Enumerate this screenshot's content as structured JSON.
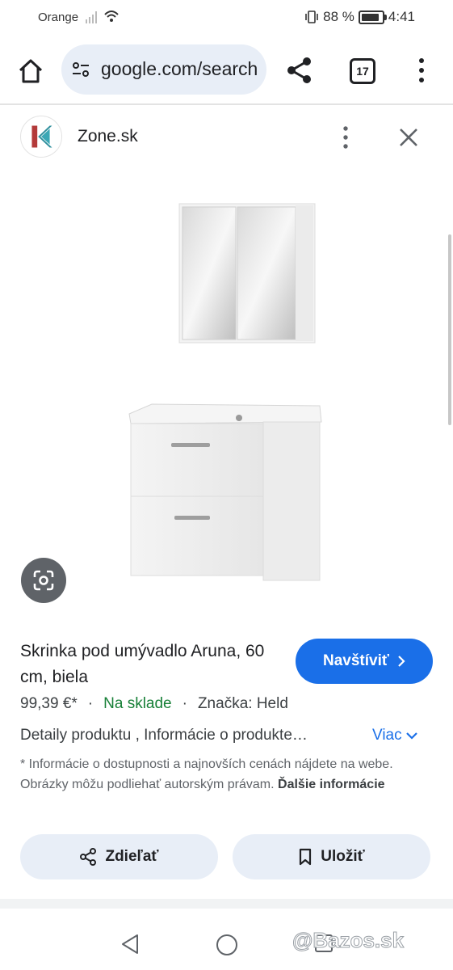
{
  "status_bar": {
    "carrier": "Orange",
    "battery_text": "88 %",
    "battery_level": 0.88,
    "time": "4:41"
  },
  "browser": {
    "url": "google.com/search",
    "tab_count": "17"
  },
  "site": {
    "name": "Zone.sk"
  },
  "product": {
    "title": "Skrinka pod umývadlo Aruna, 60 cm, biela",
    "visit_label": "Navštíviť",
    "price": "99,39 €*",
    "stock": "Na sklade",
    "brand": "Značka: Held",
    "details": "Detaily produktu , Informácie o produkte…",
    "more_label": "Viac",
    "disclaimer": "* Informácie o dostupnosti a najnovších cenách nájdete na webe. Obrázky môžu podliehať autorským právam.",
    "disclaimer_link": "Ďalšie informácie"
  },
  "actions": {
    "share_label": "Zdieľať",
    "save_label": "Uložiť"
  },
  "watermark": "@Bazos.sk",
  "colors": {
    "accent": "#1a6fe8",
    "stock_green": "#188038",
    "chip_bg": "#e8eef7"
  }
}
